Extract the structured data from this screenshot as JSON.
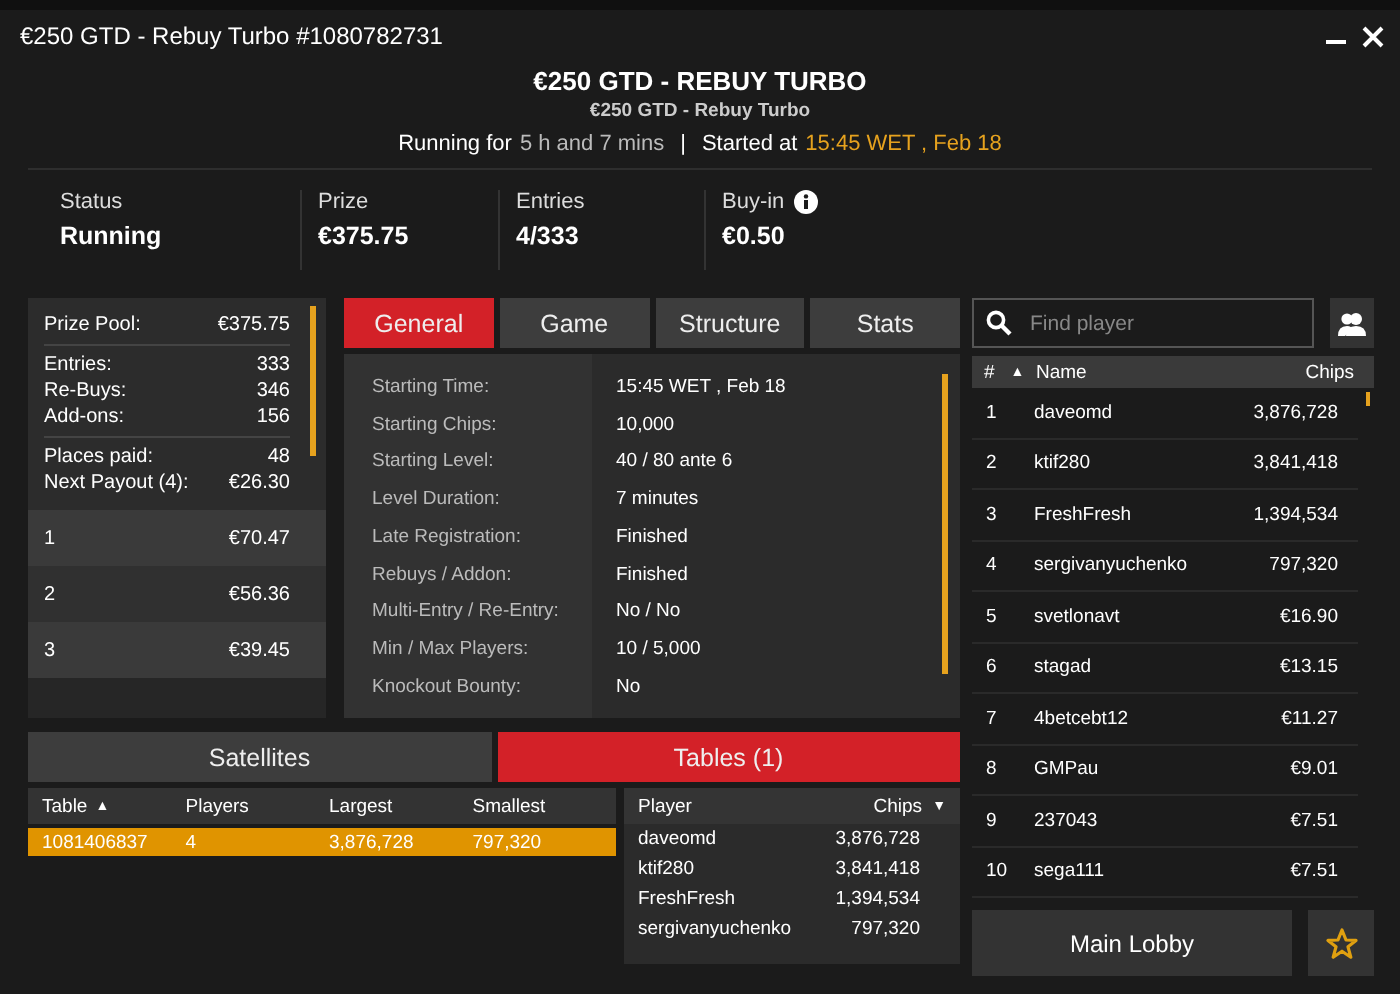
{
  "window": {
    "title": "€250 GTD - Rebuy Turbo #1080782731"
  },
  "header": {
    "title": "€250 GTD - REBUY TURBO",
    "subtitle": "€250 GTD - Rebuy Turbo",
    "running_label": "Running for",
    "running_value": "5 h and 7 mins",
    "separator": "|",
    "started_label": "Started at",
    "started_value": "15:45 WET , Feb 18"
  },
  "stats": [
    {
      "label": "Status",
      "value": "Running",
      "info_icon": false
    },
    {
      "label": "Prize",
      "value": "€375.75",
      "info_icon": false
    },
    {
      "label": "Entries",
      "value": "4/333",
      "info_icon": false
    },
    {
      "label": "Buy-in",
      "value": "€0.50",
      "info_icon": true
    }
  ],
  "prize_sections": [
    [
      {
        "label": "Prize Pool:",
        "value": "€375.75"
      }
    ],
    [
      {
        "label": "Entries:",
        "value": "333"
      },
      {
        "label": "Re-Buys:",
        "value": "346"
      },
      {
        "label": "Add-ons:",
        "value": "156"
      }
    ],
    [
      {
        "label": "Places paid:",
        "value": "48"
      },
      {
        "label": "Next Payout (4):",
        "value": "€26.30"
      }
    ]
  ],
  "payouts": [
    {
      "place": "1",
      "amount": "€70.47"
    },
    {
      "place": "2",
      "amount": "€56.36"
    },
    {
      "place": "3",
      "amount": "€39.45"
    }
  ],
  "info_tabs": [
    {
      "label": "General",
      "selected": true
    },
    {
      "label": "Game",
      "selected": false
    },
    {
      "label": "Structure",
      "selected": false
    },
    {
      "label": "Stats",
      "selected": false
    }
  ],
  "general_rows": [
    {
      "label": "Starting Time:",
      "value": "15:45 WET , Feb 18"
    },
    {
      "label": "Starting Chips:",
      "value": "10,000"
    },
    {
      "label": "Starting Level:",
      "value": "40 / 80 ante 6"
    },
    {
      "label": "Level Duration:",
      "value": "7 minutes"
    },
    {
      "label": "Late Registration:",
      "value": "Finished"
    },
    {
      "label": "Rebuys / Addon:",
      "value": "Finished"
    },
    {
      "label": "Multi-Entry / Re-Entry:",
      "value": "No / No"
    },
    {
      "label": "Min / Max Players:",
      "value": "10 / 5,000"
    },
    {
      "label": "Knockout Bounty:",
      "value": "No"
    }
  ],
  "lower_tabs": [
    {
      "label": "Satellites",
      "selected": false
    },
    {
      "label": "Tables (1)",
      "selected": true
    }
  ],
  "tables": {
    "columns": [
      {
        "label": "Table",
        "sort_mark": "▲"
      },
      {
        "label": "Players"
      },
      {
        "label": "Largest"
      },
      {
        "label": "Smallest"
      }
    ],
    "rows": [
      {
        "cells": [
          "1081406837",
          "4",
          "3,876,728",
          "797,320"
        ],
        "selected": true
      }
    ]
  },
  "table_players": {
    "columns": [
      {
        "label": "Player"
      },
      {
        "label": "Chips",
        "sort_mark": "▼"
      }
    ],
    "rows": [
      [
        "daveomd",
        "3,876,728"
      ],
      [
        "ktif280",
        "3,841,418"
      ],
      [
        "FreshFresh",
        "1,394,534"
      ],
      [
        "sergivanyuchenko",
        "797,320"
      ]
    ]
  },
  "player_search": {
    "placeholder": "Find player"
  },
  "players": {
    "columns": [
      {
        "label": "#",
        "sort_mark": "▲"
      },
      {
        "label": "Name"
      },
      {
        "label": "Chips"
      }
    ],
    "rows": [
      [
        "1",
        "daveomd",
        "3,876,728"
      ],
      [
        "2",
        "ktif280",
        "3,841,418"
      ],
      [
        "3",
        "FreshFresh",
        "1,394,534"
      ],
      [
        "4",
        "sergivanyuchenko",
        "797,320"
      ],
      [
        "5",
        "svetlonavt",
        "€16.90"
      ],
      [
        "6",
        "stagad",
        "€13.15"
      ],
      [
        "7",
        "4betcebt12",
        "€11.27"
      ],
      [
        "8",
        "GMPau",
        "€9.01"
      ],
      [
        "9",
        "237043",
        "€7.51"
      ],
      [
        "10",
        "sega111",
        "€7.51"
      ]
    ]
  },
  "main_lobby_button": "Main Lobby"
}
